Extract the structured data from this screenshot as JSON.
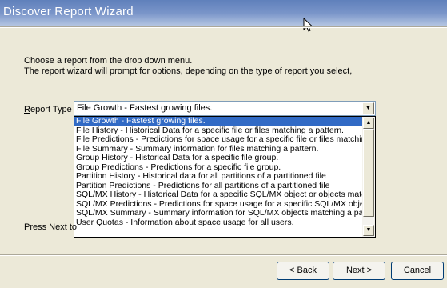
{
  "window": {
    "title": "Discover Report Wizard"
  },
  "intro": {
    "line1": "Choose a report from the drop down menu.",
    "line2": "The report wizard will prompt for options, depending on the type of report you select,"
  },
  "report_type": {
    "label_prefix": "R",
    "label_rest": "eport Type",
    "selected_value": "File Growth - Fastest growing files.",
    "options": [
      "File Growth - Fastest growing files.",
      "File History - Historical Data for a specific file or files matching a pattern.",
      "File Predictions - Predictions for space usage for a specific file or files matching a pattern.",
      "File Summary - Summary information for files matching a pattern.",
      "Group History - Historical Data for a specific file group.",
      "Group Predictions - Predictions for a specific file group.",
      "Partition History - Historical data for all partitions of a partitioned file",
      "Partition Predictions - Predictions for all partitions of a partitioned file",
      "SQL/MX History - Historical Data for a specific SQL/MX object or objects matching a pattern.",
      "SQL/MX Predictions - Predictions for space usage for a specific SQL/MX object or objects.",
      "SQL/MX Summary - Summary information for SQL/MX objects matching a pattern.",
      "User Quotas - Information about space usage for all users."
    ],
    "selected_index": 0
  },
  "press_next_text": "Press Next to",
  "buttons": {
    "back": "< Back",
    "next": "Next >",
    "cancel": "Cancel"
  },
  "icons": {
    "combo_arrow": "chevron-down-icon",
    "scroll_up": "scroll-up-icon",
    "scroll_down": "scroll-down-icon",
    "cursor": "mouse-cursor-icon"
  }
}
